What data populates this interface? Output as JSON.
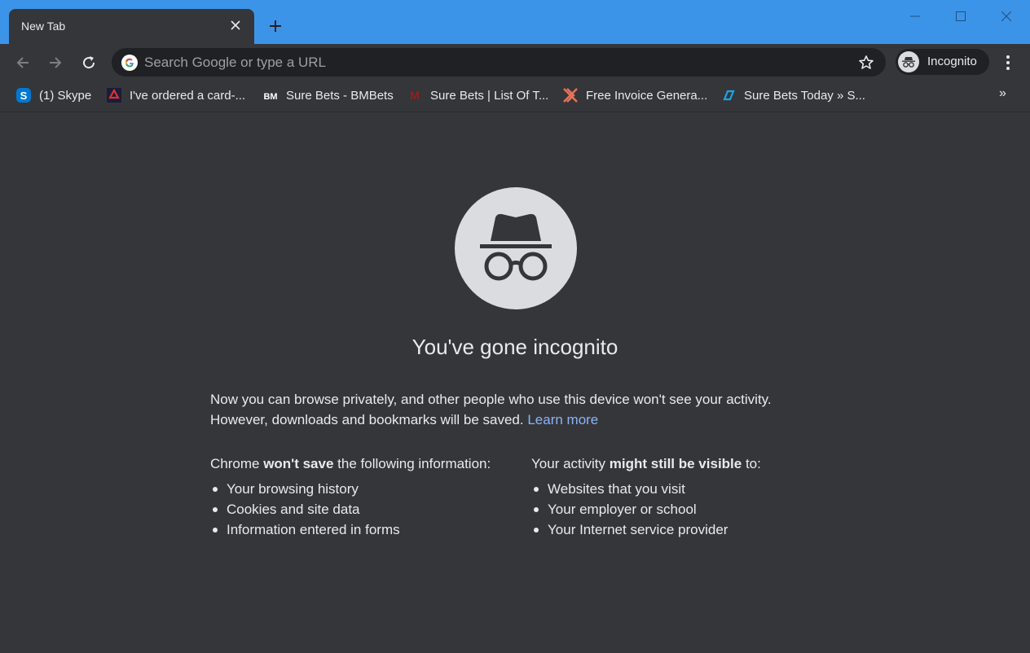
{
  "window": {
    "titlebar_color": "#3c94e8",
    "tab_title": "New Tab",
    "icons": [
      "close-icon",
      "plus-icon",
      "minimize-icon",
      "maximize-icon",
      "window-close-icon"
    ]
  },
  "toolbar": {
    "omnibox_placeholder": "Search Google or type a URL",
    "profile_label": "Incognito"
  },
  "bookmarks": [
    {
      "label": "(1) Skype",
      "icon": "skype-icon",
      "icon_text": "S",
      "color": "#0078d4"
    },
    {
      "label": "I've ordered a card-...",
      "icon": "bookmark-favicon",
      "icon_text": "",
      "color": "#e0312b"
    },
    {
      "label": "Sure Bets - BMBets",
      "icon": "bmbets-icon",
      "icon_text": "BM",
      "color": "#ffffff"
    },
    {
      "label": "Sure Bets | List Of T...",
      "icon": "bookmark-favicon",
      "icon_text": "M",
      "color": "#9b1c1c"
    },
    {
      "label": "Free Invoice Genera...",
      "icon": "invoice-icon",
      "icon_text": "",
      "color": "#e8745a"
    },
    {
      "label": "Sure Bets Today » S...",
      "icon": "bookmark-favicon",
      "icon_text": "",
      "color": "#1aa3e8"
    }
  ],
  "bookmarks_more": "»",
  "content": {
    "heading": "You've gone incognito",
    "para_line1": "Now you can browse privately, and other people who use this device won't see your activity.",
    "para_line2": "However, downloads and bookmarks will be saved.",
    "learn_more": "Learn more",
    "left_head_pre": "Chrome ",
    "left_head_bold": "won't save",
    "left_head_post": " the following information:",
    "left_items": [
      "Your browsing history",
      "Cookies and site data",
      "Information entered in forms"
    ],
    "right_head_pre": "Your activity ",
    "right_head_bold": "might still be visible",
    "right_head_post": " to:",
    "right_items": [
      "Websites that you visit",
      "Your employer or school",
      "Your Internet service provider"
    ]
  }
}
